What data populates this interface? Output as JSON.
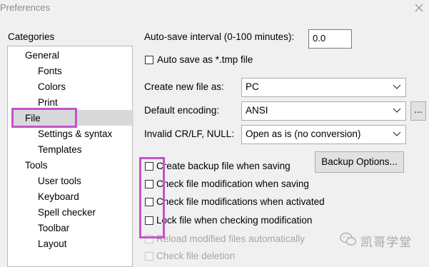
{
  "window": {
    "title": "Preferences"
  },
  "categories": {
    "heading": "Categories",
    "items": [
      {
        "label": "General",
        "level": 1
      },
      {
        "label": "Fonts",
        "level": 2
      },
      {
        "label": "Colors",
        "level": 2
      },
      {
        "label": "Print",
        "level": 2
      },
      {
        "label": "File",
        "level": 1,
        "selected": true
      },
      {
        "label": "Settings & syntax",
        "level": 2
      },
      {
        "label": "Templates",
        "level": 2
      },
      {
        "label": "Tools",
        "level": 1
      },
      {
        "label": "User tools",
        "level": 2
      },
      {
        "label": "Keyboard",
        "level": 2
      },
      {
        "label": "Spell checker",
        "level": 2
      },
      {
        "label": "Toolbar",
        "level": 2
      },
      {
        "label": "Layout",
        "level": 2
      }
    ]
  },
  "autosave": {
    "label": "Auto-save interval (0-100 minutes):",
    "value": "0.0",
    "tmp_label": "Auto save as *.tmp file",
    "tmp_checked": false
  },
  "new_file": {
    "label": "Create new file as:",
    "value": "PC"
  },
  "encoding": {
    "label": "Default encoding:",
    "value": "ANSI",
    "more_button": "..."
  },
  "crlf": {
    "label": "Invalid CR/LF, NULL:",
    "value": "Open as is (no conversion)"
  },
  "backup_button": "Backup Options...",
  "checkboxes": [
    {
      "label": "Create backup file when saving",
      "checked": false,
      "disabled": false
    },
    {
      "label": "Check file modification when saving",
      "checked": false,
      "disabled": false
    },
    {
      "label": "Check file modifications when activated",
      "checked": false,
      "disabled": false
    },
    {
      "label": "Lock file when checking modification",
      "checked": false,
      "disabled": false
    },
    {
      "label": "Reload modified files automatically",
      "checked": false,
      "disabled": true
    },
    {
      "label": "Check file deletion",
      "checked": false,
      "disabled": true
    }
  ],
  "watermark": {
    "text": "凯哥学堂"
  },
  "colors": {
    "highlight": "#c353c8",
    "selection": "#d9d9d9"
  }
}
